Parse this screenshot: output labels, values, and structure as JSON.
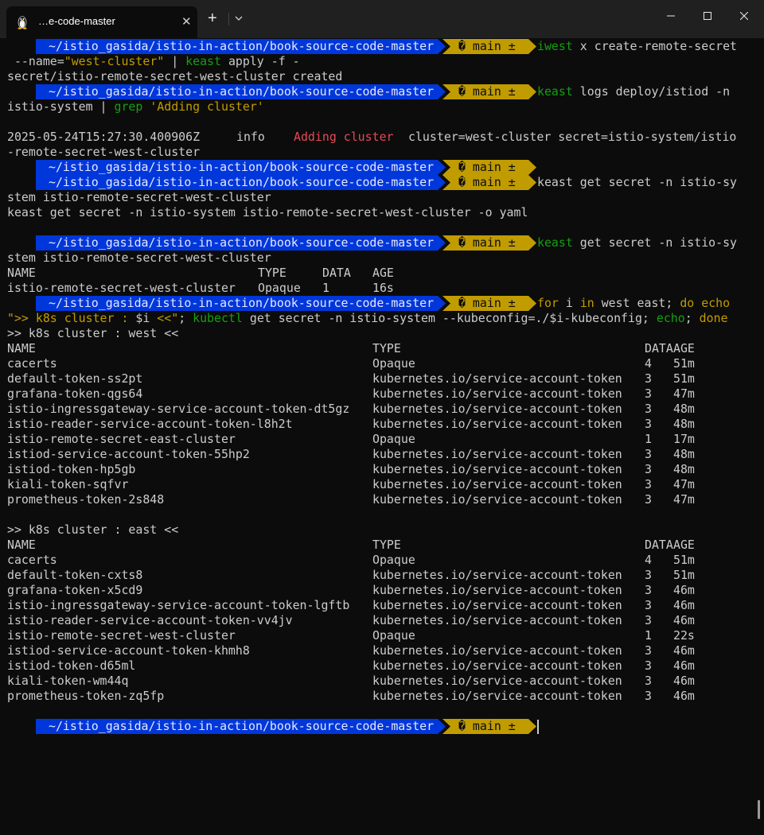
{
  "window": {
    "tab_title": "…e-code-master",
    "tab_icon": "linux-tux-icon",
    "new_tab_label": "+",
    "close_label": "✕",
    "controls": [
      "minimize-icon",
      "maximize-icon",
      "close-icon"
    ]
  },
  "colors": {
    "background": "#0c0c0c",
    "titlebar": "#202020",
    "path_segment": "#0037da",
    "git_segment": "#c19c00",
    "command_green": "#13a10e",
    "string_yellow": "#c19c00",
    "error_red": "#e74856",
    "text": "#cccccc"
  },
  "prompt": {
    "icon": "⚡",
    "path": "~/istio_gasida/istio-in-action/book-source-code-master",
    "git": "� main ±"
  },
  "block1": {
    "cmd1": "iwest",
    "cmd1_rest": " x create-remote-secret",
    "l2a": " --name=",
    "l2b": "\"west-cluster\"",
    "l2c": " | ",
    "l2d": "keast",
    "l2e": " apply -f -",
    "l3": "secret/istio-remote-secret-west-cluster created"
  },
  "block2": {
    "cmd": "keast",
    "cmd_rest": " logs deploy/istiod -n",
    "l2a": "istio-system | ",
    "l2b": "grep",
    "l2c": " ",
    "l2d": "'Adding cluster'",
    "log_ts": "2025-05-24T15:27:30.400906Z",
    "log_level": "info",
    "log_msg": "Adding cluster",
    "log_rest": "cluster=west-cluster secret=istio-system/istio",
    "log_cont": "-remote-secret-west-cluster"
  },
  "block3": {
    "cmd": "keast get secret -n istio-sy",
    "l2": "stem istio-remote-secret-west-cluster",
    "l3": "keast get secret -n istio-system istio-remote-secret-west-cluster -o yaml"
  },
  "block4": {
    "cmd": "keast",
    "cmd_rest": " get secret -n istio-sy",
    "l2": "stem istio-remote-secret-west-cluster",
    "headers": [
      "NAME",
      "TYPE",
      "DATA",
      "AGE"
    ],
    "row": [
      "istio-remote-secret-west-cluster",
      "Opaque",
      "1",
      "16s"
    ]
  },
  "block5": {
    "c1": "for",
    "c2": " i ",
    "c3": "in",
    "c4": " west east; ",
    "c5": "do",
    "c6": " ",
    "c7": "echo",
    "l2a": "\">> k8s cluster : ",
    "l2b": "$i",
    "l2c": " <<\"",
    "l2d": "; ",
    "l2e": "kubectl",
    "l2f": " get secret -n istio-system --kubeconfig=./$i-kubeconfig; ",
    "l2g": "echo",
    "l2h": "; ",
    "l2i": "done"
  },
  "west": {
    "heading": ">> k8s cluster : west <<",
    "headers": [
      "NAME",
      "TYPE",
      "DATA",
      "AGE"
    ],
    "rows": [
      [
        "cacerts",
        "Opaque",
        "4",
        "51m"
      ],
      [
        "default-token-ss2pt",
        "kubernetes.io/service-account-token",
        "3",
        "51m"
      ],
      [
        "grafana-token-qgs64",
        "kubernetes.io/service-account-token",
        "3",
        "47m"
      ],
      [
        "istio-ingressgateway-service-account-token-dt5gz",
        "kubernetes.io/service-account-token",
        "3",
        "48m"
      ],
      [
        "istio-reader-service-account-token-l8h2t",
        "kubernetes.io/service-account-token",
        "3",
        "48m"
      ],
      [
        "istio-remote-secret-east-cluster",
        "Opaque",
        "1",
        "17m"
      ],
      [
        "istiod-service-account-token-55hp2",
        "kubernetes.io/service-account-token",
        "3",
        "48m"
      ],
      [
        "istiod-token-hp5gb",
        "kubernetes.io/service-account-token",
        "3",
        "48m"
      ],
      [
        "kiali-token-sqfvr",
        "kubernetes.io/service-account-token",
        "3",
        "47m"
      ],
      [
        "prometheus-token-2s848",
        "kubernetes.io/service-account-token",
        "3",
        "47m"
      ]
    ]
  },
  "east": {
    "heading": ">> k8s cluster : east <<",
    "headers": [
      "NAME",
      "TYPE",
      "DATA",
      "AGE"
    ],
    "rows": [
      [
        "cacerts",
        "Opaque",
        "4",
        "51m"
      ],
      [
        "default-token-cxts8",
        "kubernetes.io/service-account-token",
        "3",
        "51m"
      ],
      [
        "grafana-token-x5cd9",
        "kubernetes.io/service-account-token",
        "3",
        "46m"
      ],
      [
        "istio-ingressgateway-service-account-token-lgftb",
        "kubernetes.io/service-account-token",
        "3",
        "46m"
      ],
      [
        "istio-reader-service-account-token-vv4jv",
        "kubernetes.io/service-account-token",
        "3",
        "46m"
      ],
      [
        "istio-remote-secret-west-cluster",
        "Opaque",
        "1",
        "22s"
      ],
      [
        "istiod-service-account-token-khmh8",
        "kubernetes.io/service-account-token",
        "3",
        "46m"
      ],
      [
        "istiod-token-d65ml",
        "kubernetes.io/service-account-token",
        "3",
        "46m"
      ],
      [
        "kiali-token-wm44q",
        "kubernetes.io/service-account-token",
        "3",
        "46m"
      ],
      [
        "prometheus-token-zq5fp",
        "kubernetes.io/service-account-token",
        "3",
        "46m"
      ]
    ]
  }
}
